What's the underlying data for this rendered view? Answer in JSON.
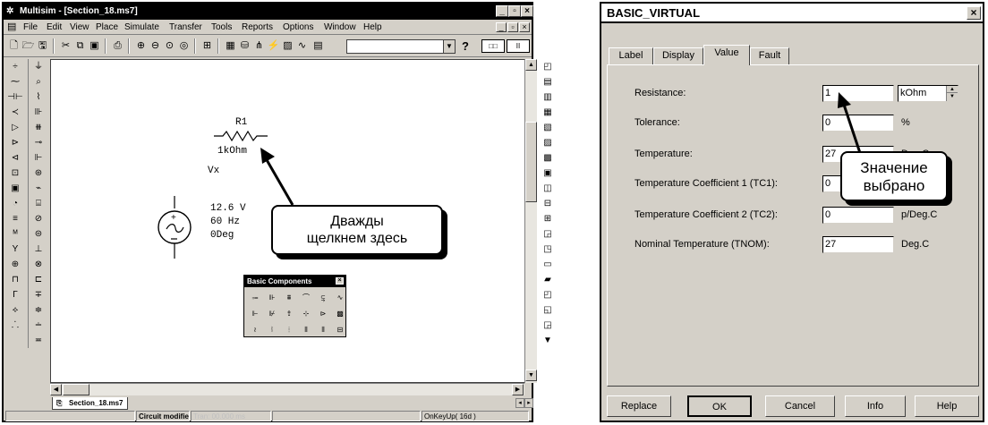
{
  "multisim": {
    "title": "Multisim - [Section_18.ms7]",
    "menu": [
      "File",
      "Edit",
      "View",
      "Place",
      "Simulate",
      "Transfer",
      "Tools",
      "Reports",
      "Options",
      "Window",
      "Help"
    ],
    "help_symbol": "?",
    "resistor": {
      "name": "R1",
      "value": "1kOhm"
    },
    "node_label": "Vx",
    "source": {
      "voltage": "12.6 V",
      "frequency": "60 Hz",
      "phase": "0Deg"
    },
    "callout": [
      "Дважды",
      "щелкнем здесь"
    ],
    "basic_components_title": "Basic Components",
    "document_tab": "Section_18.ms7",
    "status": {
      "message": "Circuit modified",
      "tran": "Tran: 00.000 ms",
      "key": "OnKeyUp( 16d )"
    }
  },
  "dialog": {
    "title": "BASIC_VIRTUAL",
    "tabs": [
      "Label",
      "Display",
      "Value",
      "Fault"
    ],
    "rows": [
      {
        "label": "Resistance:",
        "value": "1",
        "unit": "kOhm"
      },
      {
        "label": "Tolerance:",
        "value": "0",
        "unit": "%"
      },
      {
        "label": "Temperature:",
        "value": "27",
        "unit": "Deg.C"
      },
      {
        "label": "Temperature Coefficient 1 (TC1):",
        "value": "0",
        "unit": ""
      },
      {
        "label": "Temperature Coefficient 2 (TC2):",
        "value": "0",
        "unit": "p/Deg.C"
      },
      {
        "label": "Nominal Temperature (TNOM):",
        "value": "27",
        "unit": "Deg.C"
      }
    ],
    "callout": [
      "Значение",
      "выбрано"
    ],
    "buttons": [
      "Replace",
      "OK",
      "Cancel",
      "Info",
      "Help"
    ]
  }
}
